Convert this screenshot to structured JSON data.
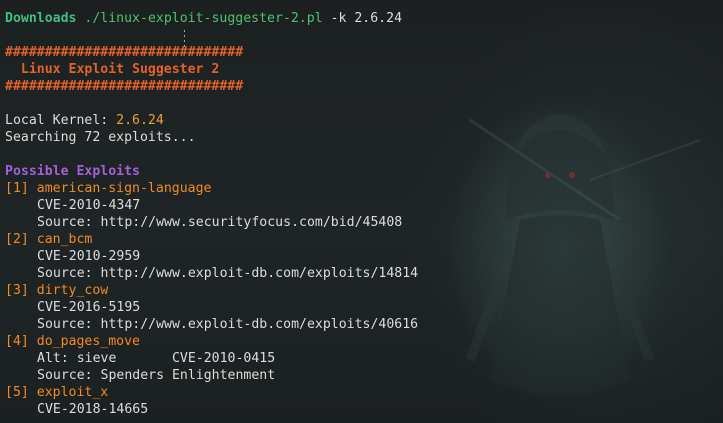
{
  "prompt": {
    "dir": "Downloads",
    "command": "./linux-exploit-suggester-2.pl",
    "args": " -k 2.6.24"
  },
  "banner": {
    "rule": "##############################",
    "title": "  Linux Exploit Suggester 2"
  },
  "kernel": {
    "label": "Local Kernel: ",
    "value": "2.6.24"
  },
  "searching": "Searching 72 exploits...",
  "section_title": "Possible Exploits",
  "exploits": [
    {
      "index": "[1]",
      "name": "american-sign-language",
      "cve": "CVE-2010-4347",
      "source": "Source: http://www.securityfocus.com/bid/45408"
    },
    {
      "index": "[2]",
      "name": "can_bcm",
      "cve": "CVE-2010-2959",
      "source": "Source: http://www.exploit-db.com/exploits/14814"
    },
    {
      "index": "[3]",
      "name": "dirty_cow",
      "cve": "CVE-2016-5195",
      "source": "Source: http://www.exploit-db.com/exploits/40616"
    },
    {
      "index": "[4]",
      "name": "do_pages_move",
      "alt": "Alt: sieve       CVE-2010-0415",
      "source": "Source: Spenders Enlightenment"
    },
    {
      "index": "[5]",
      "name": "exploit_x",
      "cve": "CVE-2018-14665"
    }
  ],
  "colors": {
    "background": "#1c2021",
    "prompt_dir": "#3fbf7f",
    "banner": "#e3622a",
    "kernel_version": "#f0a030",
    "section_title": "#a261d8",
    "exploit_name": "#f08a24"
  }
}
